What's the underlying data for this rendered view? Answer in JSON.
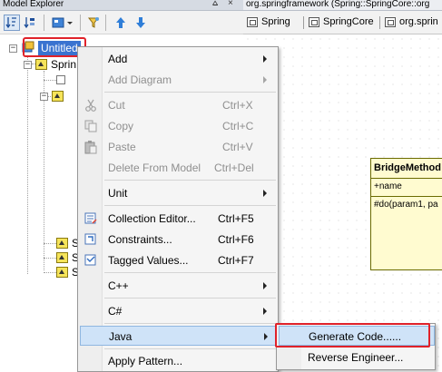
{
  "explorer": {
    "title": "Model Explorer",
    "pin_glyph": "⩟",
    "close_glyph": "×",
    "toolbar_icons": [
      "sort-icon",
      "sort-alt-icon",
      "view-icon",
      "filter-icon",
      "move-up-icon",
      "move-down-icon"
    ],
    "tree": {
      "root_label": "Untitled",
      "child_label": "Sprin",
      "stub_label": "S"
    }
  },
  "editor": {
    "title": "org.springframework (Spring::SpringCore::org",
    "tabs": [
      {
        "label": "Spring"
      },
      {
        "label": "SpringCore"
      },
      {
        "label": "org.sprin"
      }
    ],
    "uml_class": {
      "name": "BridgeMethod",
      "attribute": "+name",
      "operation": "#do(param1, pa"
    }
  },
  "context_menu": {
    "items": [
      {
        "label": "Add",
        "mnemonic": "A",
        "rest": "dd",
        "shortcut": "",
        "submenu": true,
        "disabled": false
      },
      {
        "label": "Add Diagram",
        "shortcut": "",
        "submenu": true,
        "disabled": true
      },
      {
        "label": "Cut",
        "shortcut": "Ctrl+X",
        "disabled": true,
        "icon": "scissors-icon"
      },
      {
        "label": "Copy",
        "shortcut": "Ctrl+C",
        "disabled": true,
        "icon": "copy-icon"
      },
      {
        "label": "Paste",
        "shortcut": "Ctrl+V",
        "disabled": true,
        "icon": "paste-icon"
      },
      {
        "label": "Delete From Model",
        "shortcut": "Ctrl+Del",
        "disabled": true
      },
      {
        "label": "Unit",
        "shortcut": "",
        "submenu": true,
        "disabled": false
      },
      {
        "label": "Collection Editor...",
        "shortcut": "Ctrl+F5",
        "disabled": false,
        "icon": "collection-editor-icon"
      },
      {
        "label": "Constraints...",
        "shortcut": "Ctrl+F6",
        "disabled": false,
        "icon": "constraints-icon"
      },
      {
        "label": "Tagged Values...",
        "shortcut": "Ctrl+F7",
        "disabled": false,
        "icon": "tagged-values-icon"
      },
      {
        "label": "C++",
        "shortcut": "",
        "submenu": true,
        "disabled": false
      },
      {
        "label": "C#",
        "shortcut": "",
        "submenu": true,
        "disabled": false
      },
      {
        "label": "Java",
        "shortcut": "",
        "submenu": true,
        "disabled": false,
        "highlighted": true
      },
      {
        "label": "Apply Pattern...",
        "shortcut": "",
        "disabled": false
      }
    ]
  },
  "java_submenu": {
    "items": [
      {
        "label": "Generate Code......",
        "highlighted": true
      },
      {
        "label": "Reverse Engineer..."
      }
    ]
  },
  "colors": {
    "selection": "#3a73d0",
    "highlight": "#cfe3f8",
    "annotation_red": "#e0222a",
    "uml_fill": "#fffbd0"
  }
}
